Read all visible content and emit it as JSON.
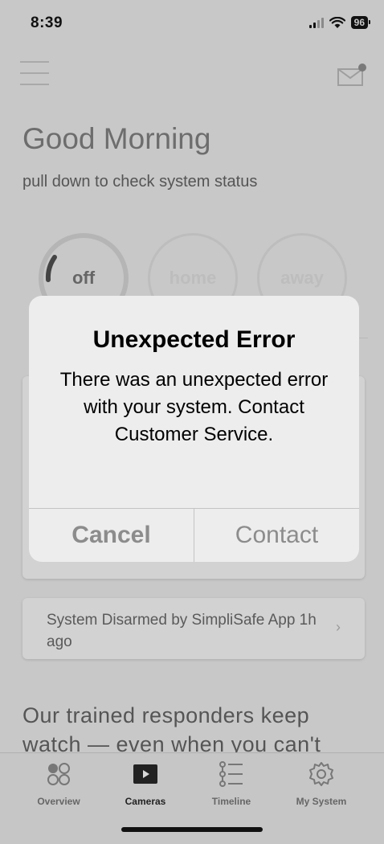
{
  "status_bar": {
    "time": "8:39",
    "battery": "96"
  },
  "header": {
    "greeting": "Good Morning",
    "subtitle": "pull down to check system status"
  },
  "modes": [
    {
      "label": "off"
    },
    {
      "label": "home"
    },
    {
      "label": "away"
    }
  ],
  "activity": {
    "text": "System Disarmed by SimpliSafe App 1h ago",
    "chevron": "›"
  },
  "promo": {
    "line1": "Our trained responders keep",
    "line2": "watch — even when you can't"
  },
  "tabs": [
    {
      "label": "Overview",
      "icon": "overview-icon"
    },
    {
      "label": "Cameras",
      "icon": "camera-play-icon"
    },
    {
      "label": "Timeline",
      "icon": "timeline-list-icon"
    },
    {
      "label": "My System",
      "icon": "gear-icon"
    }
  ],
  "dialog": {
    "title": "Unexpected Error",
    "message": "There was an unexpected error with your system. Contact Customer Service.",
    "cancel_label": "Cancel",
    "contact_label": "Contact"
  },
  "colors": {
    "background": "#c8c8c8",
    "dialog": "#ededed",
    "dialog_button_text": "#8c8c8c"
  }
}
